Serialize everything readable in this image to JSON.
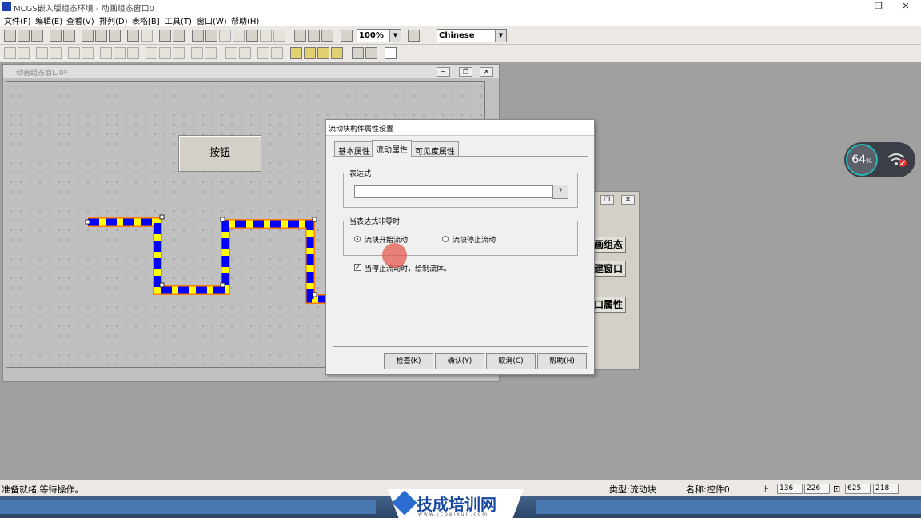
{
  "app": {
    "title": "MCGS嵌入版组态环境 - 动画组态窗口0",
    "window_buttons": [
      "−",
      "❐",
      "✕"
    ]
  },
  "menu": [
    "文件(F)",
    "编辑(E)",
    "查看(V)",
    "排列(D)",
    "表格[B]",
    "工具(T)",
    "窗口(W)",
    "帮助(H)"
  ],
  "toolbar": {
    "zoom": "100%",
    "language": "Chinese"
  },
  "mdi": {
    "title": "动画组态窗口0*",
    "button_object": "按钮"
  },
  "bg_window": {
    "buttons": [
      "画组态",
      "建窗口",
      "口属性"
    ]
  },
  "dialog": {
    "title": "流动块构件属性设置",
    "tabs": [
      "基本属性",
      "流动属性",
      "可见度属性"
    ],
    "expr_group": "表达式",
    "expr_value": "",
    "expr_btn": "?",
    "nonzero_group": "当表达式非零时",
    "radio_start": "流块开始流动",
    "radio_stop": "流块停止流动",
    "check_draw": "当停止流动时，绘制流体。",
    "buttons": [
      "检查(K)",
      "确认(Y)",
      "取消(C)",
      "帮助(H)"
    ]
  },
  "status": {
    "ready": "准备就绪,等待操作。",
    "type": "类型:流动块",
    "name": "名称:控件0",
    "x": "136",
    "y": "226",
    "w": "625",
    "h": "218"
  },
  "overlay": {
    "net_percent": "64",
    "net_unit": "%"
  },
  "brand": {
    "text": "技成培训网",
    "url": "www.jcpeixun.com"
  },
  "colors": {
    "pipe_fill": "#ffff00",
    "pipe_dash": "#0000ff",
    "pipe_border": "#ff8000",
    "accent": "#1a4aa0"
  }
}
